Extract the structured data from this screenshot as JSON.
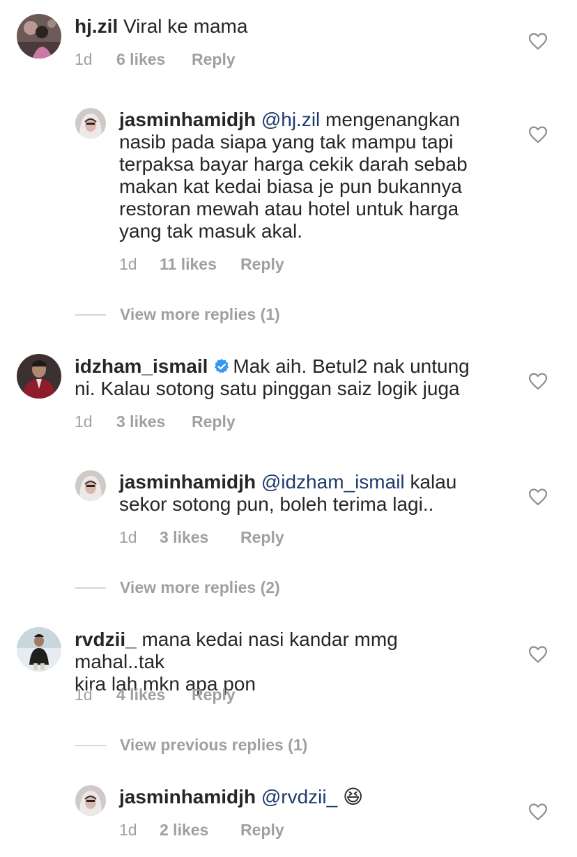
{
  "comments": [
    {
      "username": "hj.zil",
      "text": "Viral ke mama",
      "time": "1d",
      "likes": "6 likes",
      "reply": "Reply",
      "reply_item": {
        "username": "jasminhamidjh",
        "mention": "@hj.zil",
        "text": "mengenangkan\nnasib pada siapa yang tak mampu tapi\nterpaksa bayar harga cekik darah sebab\nmakan kat kedai biasa je pun  bukannya\nrestoran mewah atau hotel untuk harga\nyang tak masuk akal.",
        "time": "1d",
        "likes": "11 likes",
        "reply": "Reply"
      },
      "more_replies": "View more replies (1)"
    },
    {
      "username": "idzham_ismail",
      "verified": true,
      "text": "Mak aih. Betul2 nak untung\nni. Kalau sotong satu pinggan saiz logik juga",
      "time": "1d",
      "likes": "3 likes",
      "reply": "Reply",
      "reply_item": {
        "username": "jasminhamidjh",
        "mention": "@idzham_ismail",
        "text": "kalau\nsekor sotong pun, boleh terima lagi..",
        "time": "1d",
        "likes": "3 likes",
        "reply": "Reply"
      },
      "more_replies": "View more replies (2)"
    },
    {
      "username": "rvdzii_",
      "text": "mana kedai nasi kandar mmg mahal..tak\nkira lah mkn apa pon",
      "time": "1d",
      "likes": "4 likes",
      "reply": "Reply",
      "previous_replies": "View previous replies (1)",
      "reply_item": {
        "username": "jasminhamidjh",
        "mention": "@rvdzii_",
        "emoji": "😆",
        "time": "1d",
        "likes": "2 likes",
        "reply": "Reply"
      }
    }
  ],
  "colors": {
    "text": "#262626",
    "meta": "#a0a0a0",
    "mention": "#1f3b6e",
    "verified": "#3897f0",
    "heart": "#8e8e8e"
  }
}
